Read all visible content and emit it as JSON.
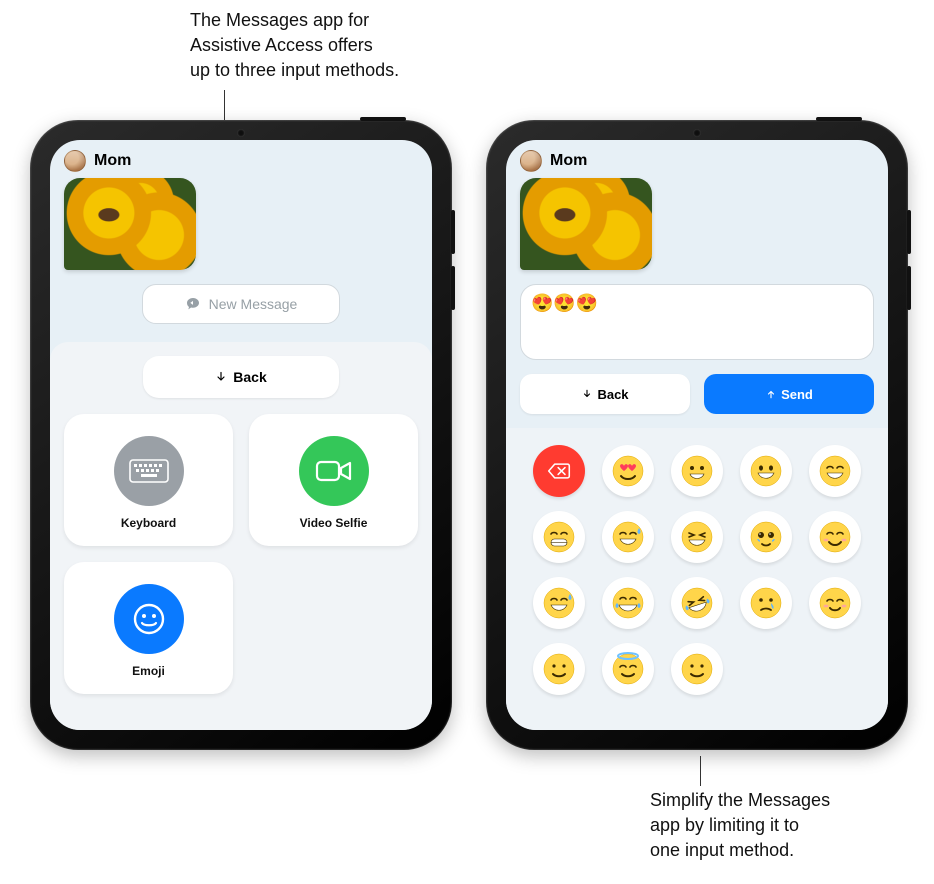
{
  "callouts": {
    "top": "The Messages app for\nAssistive Access offers\nup to three input methods.",
    "bottom": "Simplify the Messages\napp by limiting it to\none input method."
  },
  "left_ipad": {
    "contact_name": "Mom",
    "new_message_label": "New Message",
    "back_label": "Back",
    "methods": {
      "keyboard": "Keyboard",
      "video": "Video Selfie",
      "emoji": "Emoji"
    },
    "received_image_alt": "sunflowers photo"
  },
  "right_ipad": {
    "contact_name": "Mom",
    "compose_value": "😍😍😍",
    "back_label": "Back",
    "send_label": "Send",
    "emoji_keys": [
      "⌫",
      "😍",
      "😀",
      "😃",
      "😄",
      "😁",
      "😅",
      "😆",
      "🥹",
      "😊",
      "😅",
      "😂",
      "🤣",
      "😢",
      "☺️",
      "🙂",
      "😇",
      "🙂"
    ]
  }
}
